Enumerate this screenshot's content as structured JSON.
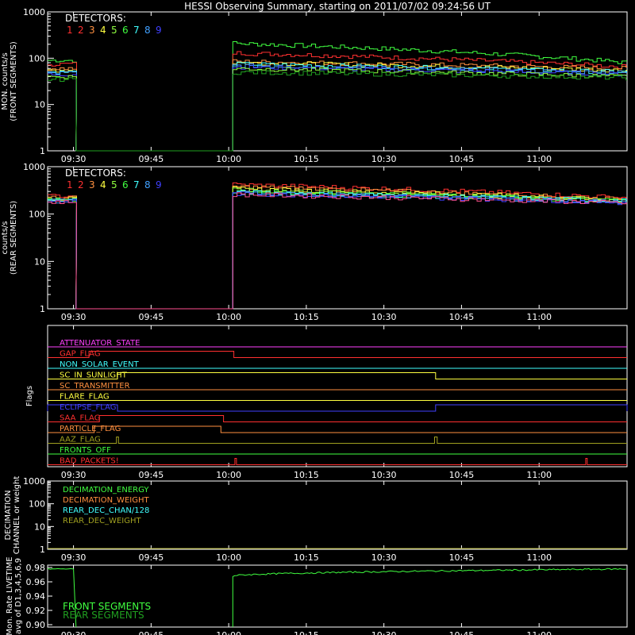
{
  "title": "HESSI Observing Summary, starting on 2011/07/02 09:24:56 UT",
  "time_ticks": [
    "09:30",
    "09:45",
    "10:00",
    "10:15",
    "10:30",
    "10:45",
    "11:00"
  ],
  "detector_colors": [
    "#ff3030",
    "#ff3030",
    "#ff9040",
    "#ffff40",
    "#90ff40",
    "#40ff40",
    "#40ffff",
    "#40a0ff",
    "#4040ff"
  ],
  "chart_data": [
    {
      "type": "line",
      "id": "front",
      "ylabel_lines": [
        "MON. counts/s",
        "(FRONT SEGMENTS)"
      ],
      "yscale": "log",
      "ylim": [
        1,
        1000
      ],
      "yticks": [
        "1",
        "10",
        "100",
        "1000"
      ],
      "legend_title": "DETECTORS:",
      "legend_items": [
        "1",
        "2",
        "3",
        "4",
        "5",
        "6",
        "7",
        "8",
        "9"
      ],
      "time_range_min": [
        0,
        112
      ],
      "gap_min": [
        5.5,
        35.8
      ],
      "series": [
        {
          "before": 90,
          "after_start": 210,
          "after_end": 80,
          "color": "#40ff40"
        },
        {
          "before": 75,
          "after_start": 130,
          "after_end": 65,
          "color": "#ff3030"
        },
        {
          "before": 60,
          "after_start": 85,
          "after_end": 60,
          "color": "#ff9040"
        },
        {
          "before": 55,
          "after_start": 80,
          "after_end": 55,
          "color": "#ffff40"
        },
        {
          "before": 50,
          "after_start": 75,
          "after_end": 50,
          "color": "#40ffff"
        },
        {
          "before": 48,
          "after_start": 70,
          "after_end": 48,
          "color": "#40a0ff"
        },
        {
          "before": 45,
          "after_start": 65,
          "after_end": 45,
          "color": "#4040ff"
        },
        {
          "before": 40,
          "after_start": 60,
          "after_end": 40,
          "color": "#90ff40"
        },
        {
          "before": 35,
          "after_start": 50,
          "after_end": 38,
          "color": "#20a020"
        }
      ]
    },
    {
      "type": "line",
      "id": "rear",
      "ylabel_lines": [
        "counts/s",
        "(REAR SEGMENTS)"
      ],
      "yscale": "log",
      "ylim": [
        1,
        1000
      ],
      "yticks": [
        "1",
        "10",
        "100",
        "1000"
      ],
      "legend_title": "DETECTORS:",
      "legend_items": [
        "1",
        "2",
        "3",
        "4",
        "5",
        "6",
        "7",
        "8",
        "9"
      ],
      "time_range_min": [
        0,
        112
      ],
      "gap_min": [
        5.5,
        35.8
      ],
      "series": [
        {
          "before": 240,
          "after_start": 420,
          "after_end": 220,
          "color": "#ff3030"
        },
        {
          "before": 220,
          "after_start": 380,
          "after_end": 200,
          "color": "#ff9040"
        },
        {
          "before": 210,
          "after_start": 340,
          "after_end": 200,
          "color": "#ffff40"
        },
        {
          "before": 205,
          "after_start": 320,
          "after_end": 195,
          "color": "#90ff40"
        },
        {
          "before": 200,
          "after_start": 300,
          "after_end": 190,
          "color": "#40ff40"
        },
        {
          "before": 195,
          "after_start": 290,
          "after_end": 190,
          "color": "#40ffff"
        },
        {
          "before": 190,
          "after_start": 280,
          "after_end": 180,
          "color": "#40a0ff"
        },
        {
          "before": 185,
          "after_start": 270,
          "after_end": 175,
          "color": "#4040ff"
        },
        {
          "before": 180,
          "after_start": 260,
          "after_end": 170,
          "color": "#ff5090"
        }
      ]
    },
    {
      "type": "line",
      "id": "flags",
      "ylabel": "Flags",
      "flags": [
        {
          "label": "ATTENUATOR_STATE",
          "color": "#ff40ff",
          "on": []
        },
        {
          "label": "GAP_FLAG",
          "color": "#ff3030",
          "on": [
            [
              8,
              36
            ]
          ]
        },
        {
          "label": "NON_SOLAR_EVENT",
          "color": "#40ffff",
          "on": []
        },
        {
          "label": "SC_IN_SUNLIGHT",
          "color": "#ffff40",
          "on": [
            [
              13.5,
              75
            ]
          ]
        },
        {
          "label": "SC_TRANSMITTER",
          "color": "#ff9040",
          "on": []
        },
        {
          "label": "FLARE_FLAG",
          "color": "#ffff40",
          "on": []
        },
        {
          "label": "ECLIPSE_FLAG",
          "color": "#4040ff",
          "on": [
            [
              0,
              13.5
            ],
            [
              75,
              112
            ]
          ]
        },
        {
          "label": "SAA_FLAG",
          "color": "#ff3030",
          "on": [
            [
              10,
              34
            ]
          ]
        },
        {
          "label": "PARTICLE_FLAG",
          "color": "#ff9040",
          "on": [
            [
              9,
              33.5
            ]
          ]
        },
        {
          "label": "AAZ_FLAG",
          "color": "#a0a020",
          "on": [
            [
              13.3,
              13.7
            ],
            [
              74.8,
              75.3
            ]
          ]
        },
        {
          "label": "FRONTS_OFF",
          "color": "#40ff40",
          "on": []
        },
        {
          "label": "BAD_PACKETS!",
          "color": "#ff3030",
          "on": [
            [
              36.2,
              36.5
            ],
            [
              104,
              104.3
            ]
          ]
        }
      ]
    },
    {
      "type": "line",
      "id": "decimation",
      "ylabel_lines": [
        "DECIMATION",
        "CHANNEL or weight"
      ],
      "yscale": "log",
      "ylim": [
        1,
        1000
      ],
      "yticks": [
        "1",
        "10",
        "100",
        "1000"
      ],
      "legend": [
        {
          "label": "DECIMATION_ENERGY",
          "color": "#40ff40"
        },
        {
          "label": "DECIMATION_WEIGHT",
          "color": "#ff9040"
        },
        {
          "label": "REAR_DEC_CHAN/128",
          "color": "#40ffff"
        },
        {
          "label": "REAR_DEC_WEIGHT",
          "color": "#a0a020"
        }
      ]
    },
    {
      "type": "line",
      "id": "livetime",
      "ylabel_lines": [
        "Mon. Rate LIVETIME",
        "avg of D1,3,4,5,6,9"
      ],
      "ylim": [
        0.9,
        0.98
      ],
      "yticks": [
        "0.90",
        "0.92",
        "0.94",
        "0.96",
        "0.98"
      ],
      "legend": [
        {
          "label": "FRONT SEGMENTS",
          "color": "#40ff40"
        },
        {
          "label": "REAR SEGMENTS",
          "color": "#20a020"
        }
      ],
      "before": 0.978,
      "after_start": 0.968,
      "after_end": 0.978
    }
  ]
}
